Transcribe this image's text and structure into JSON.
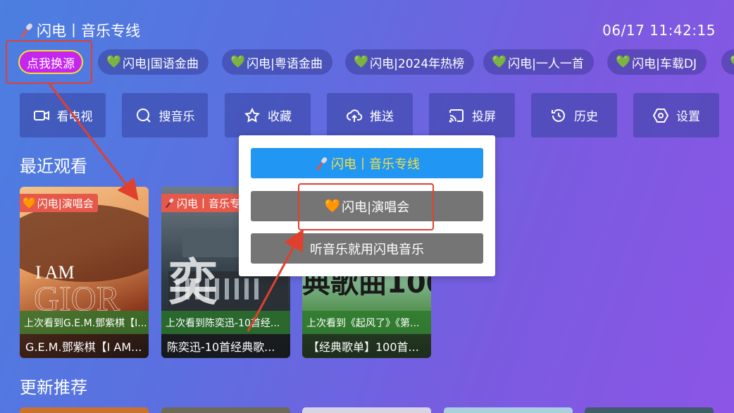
{
  "header": {
    "title_icon": "mic-icon",
    "title": "闪电丨音乐专线",
    "time": "06/17 11:42:15"
  },
  "chips": [
    {
      "label": "点我换源",
      "type": "source"
    },
    {
      "label": "闪电|国语金曲",
      "icon": "green-heart-icon"
    },
    {
      "label": "闪电|粤语金曲",
      "icon": "green-heart-icon"
    },
    {
      "label": "闪电|2024年热榜",
      "icon": "green-heart-icon"
    },
    {
      "label": "闪电|一人一首",
      "icon": "green-heart-icon"
    },
    {
      "label": "闪电|车载DJ",
      "icon": "green-heart-icon"
    }
  ],
  "nav": [
    {
      "label": "看电视",
      "icon": "tv-camera-icon"
    },
    {
      "label": "搜音乐",
      "icon": "search-icon"
    },
    {
      "label": "收藏",
      "icon": "star-icon"
    },
    {
      "label": "推送",
      "icon": "cloud-upload-icon"
    },
    {
      "label": "投屏",
      "icon": "cast-icon"
    },
    {
      "label": "历史",
      "icon": "history-icon"
    },
    {
      "label": "设置",
      "icon": "settings-icon"
    }
  ],
  "sections": {
    "recent": "最近观看",
    "updates": "更新推荐"
  },
  "recent_cards": [
    {
      "tag": "闪电|演唱会",
      "tag_icon": "orange-heart-icon",
      "history": "上次看到G.E.M.鄧紫棋【I...",
      "name": "G.E.M.鄧紫棋【I AM...",
      "art_text": "I AM GLORIA"
    },
    {
      "tag": "闪电丨音乐专",
      "tag_icon": "mic-icon",
      "history": "上次看到陈奕迅-10首经...",
      "name": "陈奕迅-10首经典歌...",
      "art_text": "奕"
    },
    {
      "tag": "",
      "history": "上次看到《起风了》《第...",
      "name": "【经典歌单】100首...",
      "art_text": "典歌曲100"
    }
  ],
  "popup": {
    "primary": "闪电丨音乐专线",
    "primary_icon": "mic-icon",
    "option1": "闪电|演唱会",
    "option1_icon": "orange-heart-icon",
    "option2": "听音乐就用闪电音乐"
  },
  "colors": {
    "accent_chip": "#c526ef",
    "chip_border": "#f3e42a",
    "annotation_red": "#e0402e",
    "popup_primary": "#2196f3",
    "popup_gray": "#757575"
  }
}
